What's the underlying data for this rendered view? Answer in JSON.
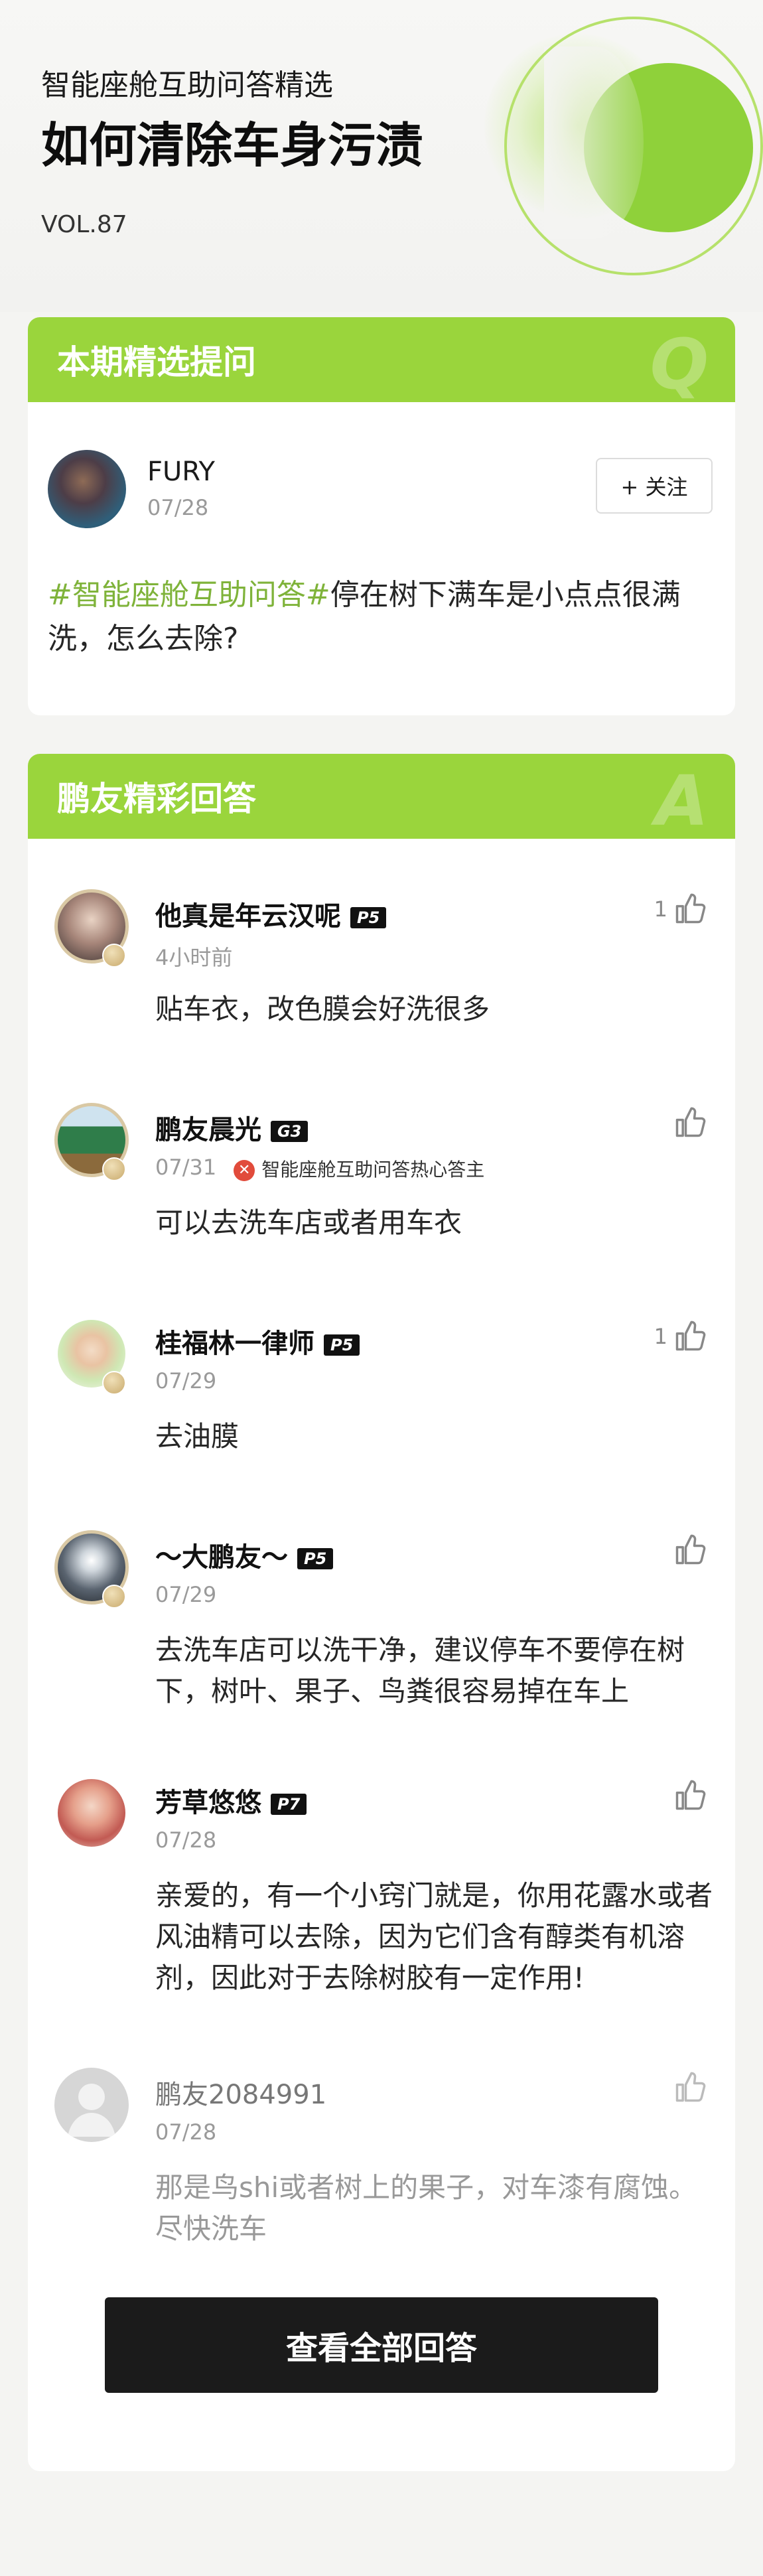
{
  "header": {
    "subtitle": "智能座舱互助问答精选",
    "title": "如何清除车身污渍",
    "volume": "VOL.87"
  },
  "question_section": {
    "title": "本期精选提问",
    "mark": "Q",
    "user": {
      "name": "FURY",
      "date": "07/28"
    },
    "follow_label": "+ 关注",
    "tag": "#智能座舱互助问答#",
    "text": "停在树下满车是小点点很满洗，怎么去除?"
  },
  "answers_section": {
    "title": "鹏友精彩回答",
    "mark": "A",
    "answers": [
      {
        "name": "他真是年云汉呢",
        "level": "P5",
        "date": "4小时前",
        "text": "贴车衣，改色膜会好洗很多",
        "likes": "1"
      },
      {
        "name": "鹏友晨光",
        "level": "G3",
        "date": "07/31",
        "hot_label": "智能座舱互助问答热心答主",
        "text": "可以去洗车店或者用车衣",
        "likes": ""
      },
      {
        "name": "桂福林一律师",
        "level": "P5",
        "date": "07/29",
        "text": "去油膜",
        "likes": "1"
      },
      {
        "name": "～大鹏友～",
        "level": "P5",
        "date": "07/29",
        "text": "去洗车店可以洗干净，建议停车不要停在树下，树叶、果子、鸟粪很容易掉在车上",
        "likes": ""
      },
      {
        "name": "芳草悠悠",
        "level": "P7",
        "date": "07/28",
        "text": "亲爱的，有一个小窍门就是，你用花露水或者风油精可以去除，因为它们含有醇类有机溶剂，因此对于去除树胶有一定作用!",
        "likes": ""
      },
      {
        "name": "鹏友2084991",
        "level": "",
        "date": "07/28",
        "text": "那是鸟shi或者树上的果子，对车漆有腐蚀。尽快洗车",
        "likes": ""
      }
    ],
    "view_all_label": "查看全部回答"
  },
  "colors": {
    "accent_green": "#9ad53c",
    "tag_green": "#7fb33a",
    "button_dark": "#1b1b1b"
  }
}
